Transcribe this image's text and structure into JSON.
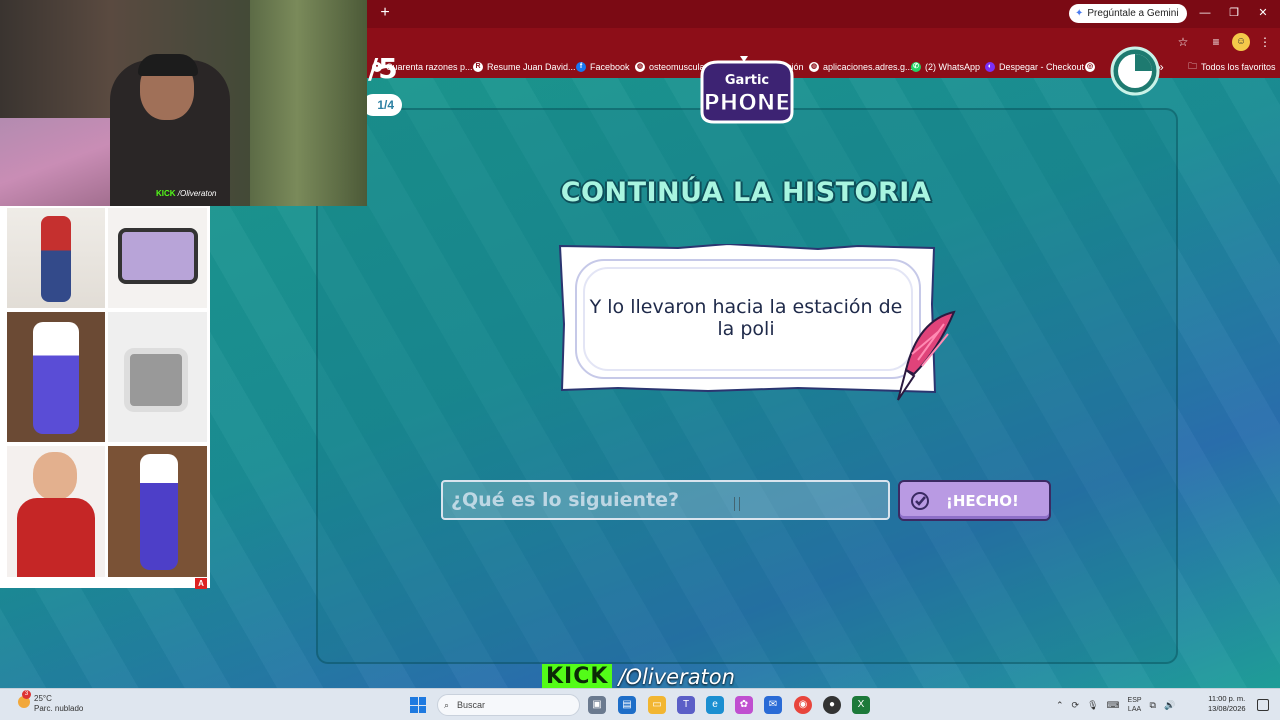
{
  "browser": {
    "gemini_label": "Pregúntale a Gemini",
    "new_tab": "+",
    "window_controls": [
      "—",
      "❐",
      "✕"
    ],
    "toolbar_icons": [
      "star-icon",
      "media-icon",
      "profile-icon",
      "menu-icon"
    ],
    "bookmarks": [
      {
        "label": "Cuarenta razones p...",
        "icon": "bookmark-icon"
      },
      {
        "label": "Resume Juan David...",
        "icon": "resume-icon"
      },
      {
        "label": "Facebook",
        "icon": "facebook-icon"
      },
      {
        "label": "osteomuscular",
        "icon": "globe-icon"
      },
      {
        "label": "",
        "icon": "facebook-icon"
      },
      {
        "label": "Configuración",
        "icon": "gear-icon"
      },
      {
        "label": "aplicaciones.adres.g...",
        "icon": "globe-icon"
      },
      {
        "label": "(2) WhatsApp",
        "icon": "whatsapp-icon"
      },
      {
        "label": "Despegar - Checkout",
        "icon": "despegar-icon"
      }
    ],
    "bookmarks_overflow": "»",
    "all_bookmarks": "Todos los favoritos"
  },
  "game": {
    "round_big": "/5",
    "round_small": "1/4",
    "logo_top": "Gartic",
    "logo_bottom": "PHONE",
    "heading": "CONTINÚA LA HISTORIA",
    "story": "Y lo llevaron hacia la estación de la poli",
    "input_placeholder": "¿Qué es lo siguiente?",
    "input_value": "",
    "done_label": "¡HECHO!",
    "timer_fraction_remaining": 0.75
  },
  "stream": {
    "kick_logo": "KICK",
    "kick_name": "/Oliveraton",
    "webcam_kick": "KICK",
    "webcam_name": "/Oliveraton",
    "image_badge": "A"
  },
  "taskbar": {
    "temperature": "25°C",
    "weather": "Parc. nublado",
    "weather_badge": "3",
    "search_label": "Buscar",
    "lang_top": "ESP",
    "lang_bottom": "LAA",
    "time": "11:00 p. m.",
    "date": "13/08/2026"
  }
}
